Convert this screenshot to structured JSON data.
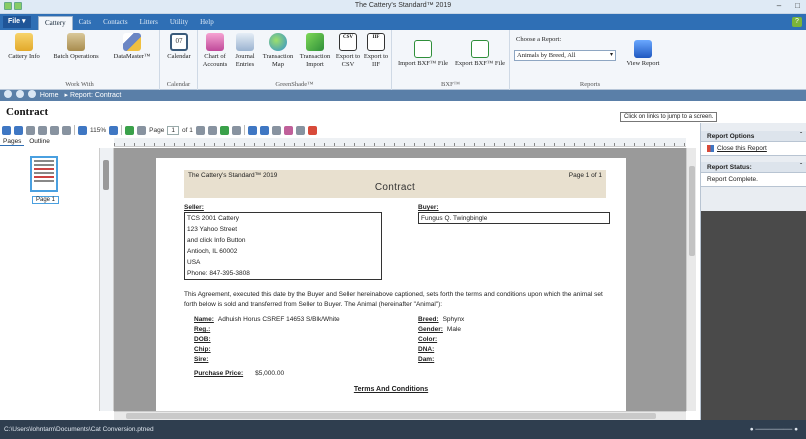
{
  "window": {
    "title": "The Cattery's Standard™ 2019"
  },
  "menu": {
    "file_label": "File ▾",
    "tabs": [
      "Cattery",
      "Cats",
      "Contacts",
      "Litters",
      "Utility",
      "Help"
    ]
  },
  "ribbon": {
    "work_with": {
      "label": "Work With",
      "buttons": [
        "Cattery Info",
        "Batch Operations",
        "DataMaster™"
      ]
    },
    "calendar": {
      "label": "Calendar",
      "buttons": [
        "Calendar"
      ],
      "icon_text": "07"
    },
    "greenshade": {
      "label": "GreenShade™",
      "buttons": [
        "Chart of Accounts",
        "Journal Entries",
        "Transaction Map",
        "Transaction Import",
        "Export to CSV",
        "Export to IIF"
      ]
    },
    "bxf": {
      "label": "BXF™",
      "buttons": [
        "Import BXF™ File",
        "Export BXF™ File"
      ]
    },
    "reports": {
      "label": "Reports",
      "choose_label": "Choose a Report:",
      "selected": "Animals by Breed, All",
      "view_button": "View Report"
    }
  },
  "breadcrumb": {
    "home": "Home",
    "separator": "▸",
    "current": "Report: Contract"
  },
  "page_title": "Contract",
  "tooltip": "Click on links to jump to a screen.",
  "toolbar": {
    "zoom": "115%",
    "page_label": "Page",
    "page_value": "1",
    "of_label": "of 1"
  },
  "left_tabs": [
    "Pages",
    "Outline"
  ],
  "thumbnail_label": "Page 1",
  "report": {
    "header_left": "The Cattery's Standard™ 2019",
    "header_right": "Page 1 of 1",
    "title": "Contract",
    "seller_label": "Seller:",
    "seller_lines": [
      "TCS 2001 Cattery",
      "123 Yahoo Street",
      "and click Info Button",
      "Antioch, IL 60002",
      "USA",
      "Phone: 847-395-3808"
    ],
    "buyer_label": "Buyer:",
    "buyer_name": "Fungus Q. Twingbingle",
    "agreement": "This Agreement, executed this date by the Buyer and Seller hereinabove captioned, sets forth the terms and conditions upon which the animal set forth below is sold and transferred from Seller to Buyer. The Animal (hereinafter \"Animal\"):",
    "fields_left": [
      {
        "label": "Name:",
        "value": "Adhuish Horus CSREF 14653 S/Blk/White"
      },
      {
        "label": "Reg.:",
        "value": ""
      },
      {
        "label": "DOB:",
        "value": ""
      },
      {
        "label": "Chip:",
        "value": ""
      },
      {
        "label": "Sire:",
        "value": ""
      }
    ],
    "fields_right": [
      {
        "label": "Breed:",
        "value": "Sphynx"
      },
      {
        "label": "Gender:",
        "value": "Male"
      },
      {
        "label": "Color:",
        "value": ""
      },
      {
        "label": "DNA:",
        "value": ""
      },
      {
        "label": "Dam:",
        "value": ""
      }
    ],
    "price_label": "Purchase Price:",
    "price_value": "$5,000.00",
    "terms_heading": "Terms And Conditions"
  },
  "right_pane": {
    "options_header": "Report Options",
    "close_report": "Close this Report",
    "status_header": "Report Status:",
    "status_text": "Report Complete."
  },
  "status_bar": {
    "path": "C:\\Users\\lohntam\\Documents\\Cat Conversion.ptned"
  },
  "colors": {
    "accent": "#2f6fb5",
    "report_header": "#e8e0cf",
    "status_bar": "#2f3e4f"
  }
}
